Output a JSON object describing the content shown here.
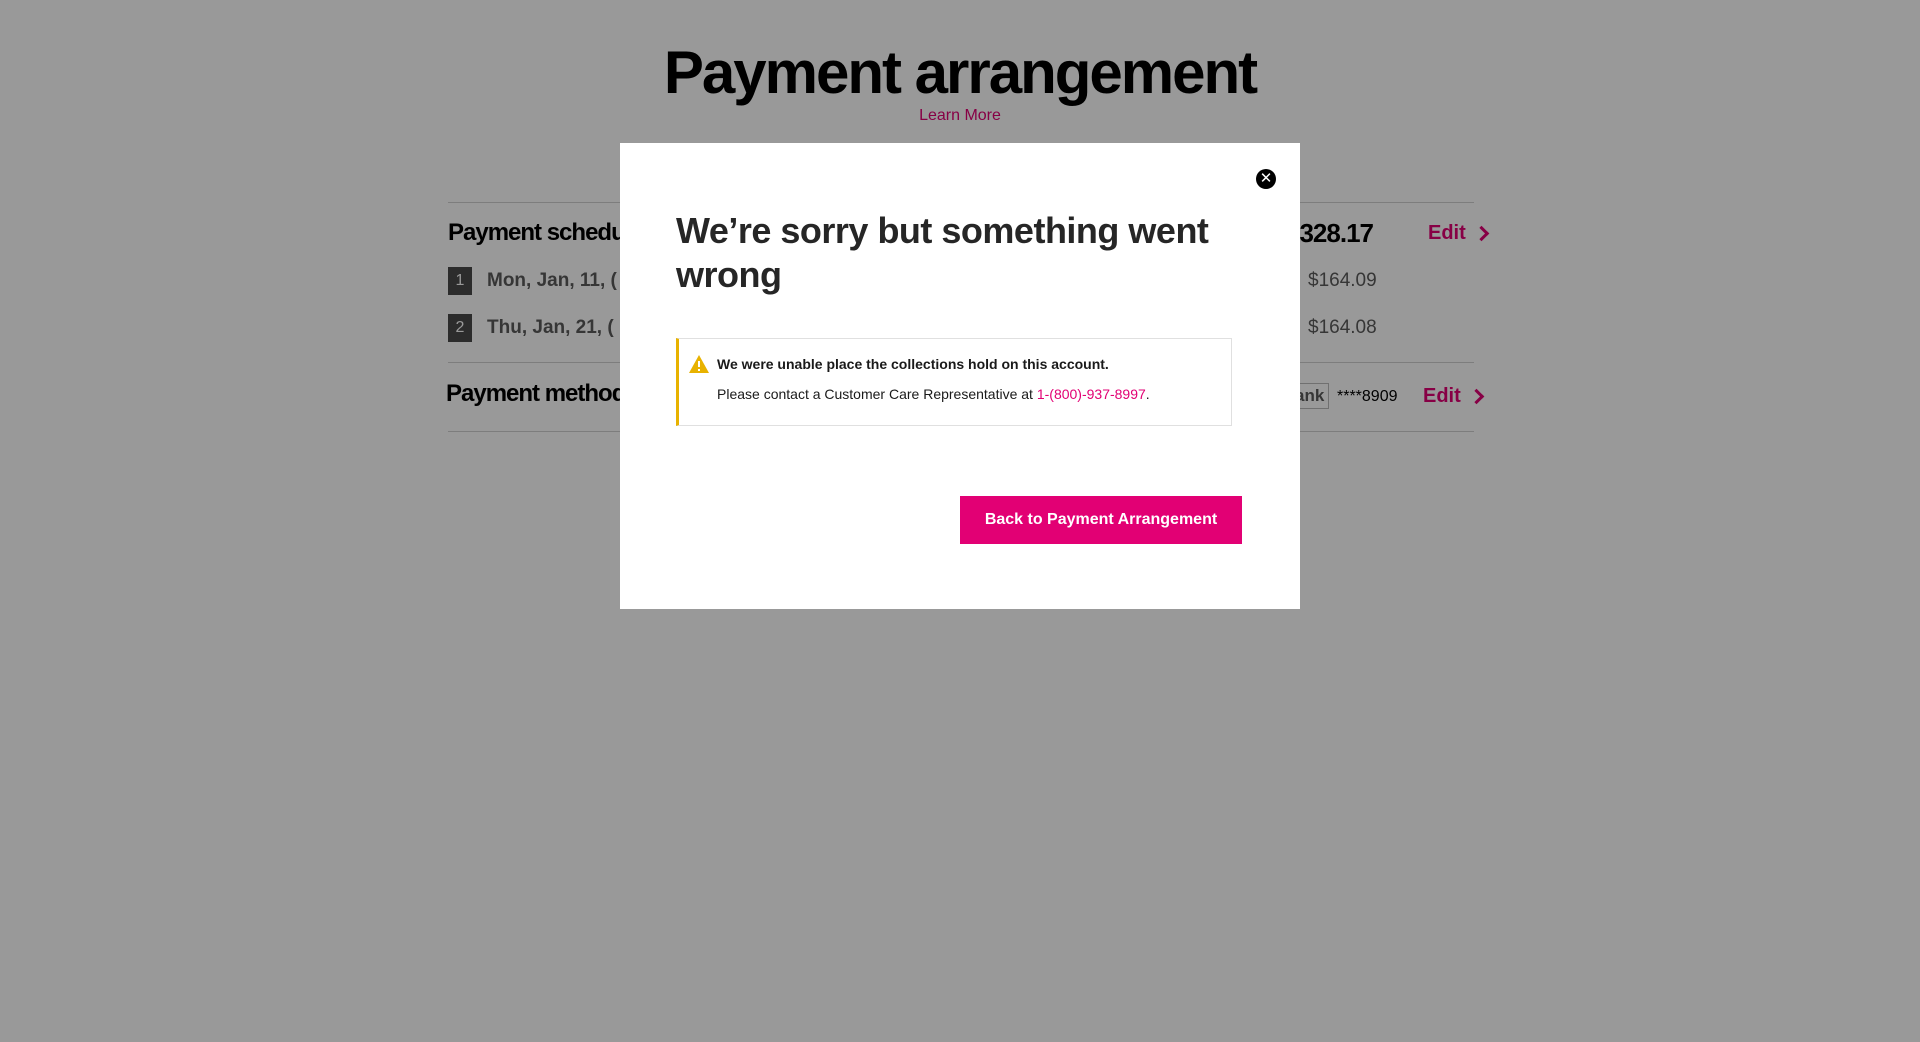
{
  "page": {
    "title": "Payment arrangement",
    "learn_more": "Learn More"
  },
  "schedule": {
    "label": "Payment schedu",
    "total": "$328.17",
    "edit_label": "Edit",
    "installments": [
      {
        "number": "1",
        "date": "Mon, Jan, 11, (",
        "amount": "$164.09"
      },
      {
        "number": "2",
        "date": "Thu, Jan, 21, (",
        "amount": "$164.08"
      }
    ]
  },
  "payment_method": {
    "label": "Payment method",
    "bank_label": "ank",
    "account_number": "****8909",
    "edit_label": "Edit"
  },
  "modal": {
    "title": "We’re sorry but something went wrong",
    "alert": {
      "heading": "We were unable place the collections hold on this account.",
      "body_prefix": "Please contact a Customer Care Representative at ",
      "phone": "1-(800)-937-8997",
      "body_suffix": "."
    },
    "primary_button": "Back to Payment Arrangement",
    "close_icon": "close-icon"
  },
  "colors": {
    "brand_magenta": "#e20074",
    "warning_yellow": "#e8b200"
  }
}
